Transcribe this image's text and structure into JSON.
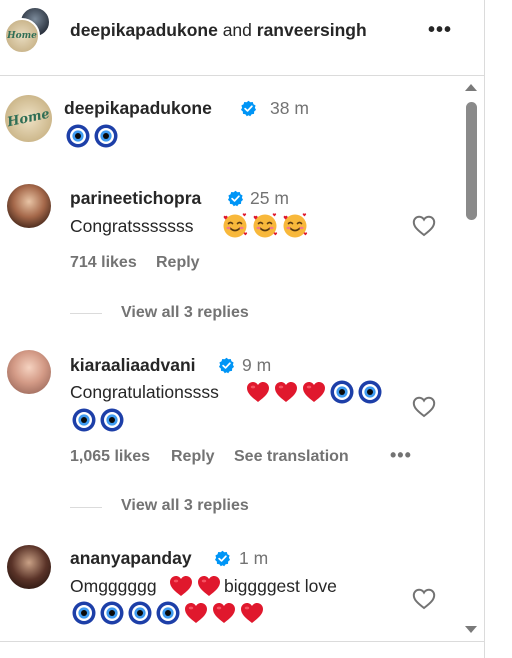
{
  "header": {
    "user1": "deepikapadukone",
    "joiner": " and ",
    "user2": "ranveersingh",
    "avatar_text": "Home",
    "more_icon": "more-horizontal-icon"
  },
  "post": {
    "username": "deepikapadukone",
    "time": "38 m",
    "emoji": [
      "nazar-amulet",
      "nazar-amulet"
    ],
    "avatar_text": "Home"
  },
  "comments": [
    {
      "username": "parineetichopra",
      "time": "25 m",
      "text": "Congratsssssss",
      "emoji": [
        "smiling-face-with-hearts",
        "smiling-face-with-hearts",
        "smiling-face-with-hearts"
      ],
      "likes": "714 likes",
      "reply": "Reply",
      "view_replies": "View all 3 replies"
    },
    {
      "username": "kiaraaliaadvani",
      "time": "9 m",
      "text": "Congratulationssss",
      "emoji_line1": [
        "red-heart",
        "red-heart",
        "red-heart",
        "nazar-amulet",
        "nazar-amulet"
      ],
      "emoji_line2": [
        "nazar-amulet",
        "nazar-amulet"
      ],
      "likes": "1,065 likes",
      "reply": "Reply",
      "see_translation": "See translation",
      "view_replies": "View all 3 replies"
    },
    {
      "username": "ananyapanday",
      "time": "1 m",
      "text_part1": "Omgggggg",
      "text_part2": " biggggest love",
      "emoji_inline": [
        "red-heart",
        "red-heart"
      ],
      "emoji_line2": [
        "nazar-amulet",
        "nazar-amulet",
        "nazar-amulet",
        "nazar-amulet",
        "red-heart",
        "red-heart",
        "red-heart"
      ]
    }
  ],
  "colors": {
    "text": "#262626",
    "secondary": "#737373",
    "verified": "#0095f6",
    "divider": "#dbdbdb",
    "heart_red": "#e0182d",
    "nazar_blue": "#1d3fa8"
  }
}
